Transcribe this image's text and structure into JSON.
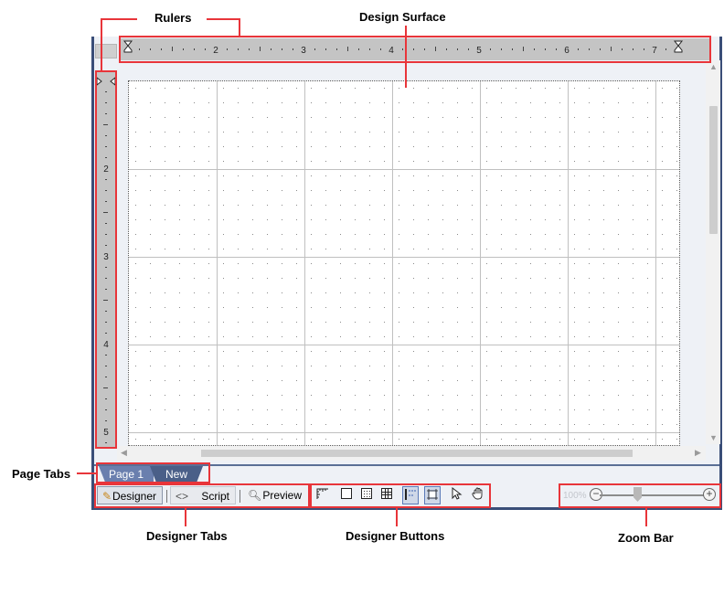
{
  "callouts": {
    "rulers": "Rulers",
    "design_surface": "Design Surface",
    "page_tabs": "Page Tabs",
    "designer_tabs": "Designer Tabs",
    "designer_buttons": "Designer Buttons",
    "zoom_bar": "Zoom Bar"
  },
  "hruler": {
    "labels": [
      "2",
      "3",
      "4",
      "5",
      "6",
      "7"
    ]
  },
  "vruler": {
    "labels": [
      "2",
      "3",
      "4",
      "5"
    ]
  },
  "page_tabs": [
    "Page 1",
    "New"
  ],
  "designer_tabs": {
    "designer": "Designer",
    "script": "Script",
    "preview": "Preview"
  },
  "designer_buttons": [
    "ruler-icon",
    "rectangle-icon",
    "dotted-grid-icon",
    "grid-icon",
    "snap-to-guides-icon",
    "fit-to-grid-icon",
    "pointer-icon",
    "hand-icon"
  ],
  "zoom": {
    "value": "100%"
  },
  "colors": {
    "callout": "#e8353a",
    "frame": "#3a4e78",
    "tab_active": "#6a7fae",
    "tab_new": "#4a5f88"
  }
}
